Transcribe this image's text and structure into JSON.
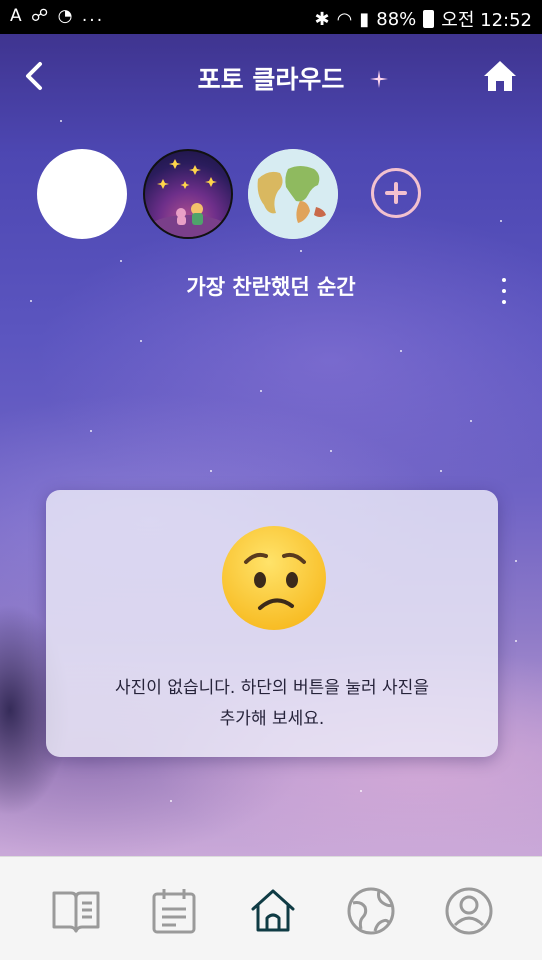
{
  "status_bar": {
    "left": "A ☍ ◔ ...",
    "battery": "88%",
    "time": "오전 12:52"
  },
  "header": {
    "title": "포토 클라우드",
    "back_icon": "chevron-left-icon",
    "home_icon": "home-icon"
  },
  "albums": {
    "items": [
      {
        "name": "album-white",
        "color": "#ffffff"
      },
      {
        "name": "album-little-prince",
        "color": "#2a1c5c"
      },
      {
        "name": "album-world-map",
        "color": "#e6f0ef"
      }
    ],
    "add_icon": "plus-circle-icon"
  },
  "album_title": "가장 찬란했던 순간",
  "empty_state": {
    "emoji": "worried-face-emoji",
    "line1": "사진이 없습니다. 하단의 버튼을 눌러 사진을",
    "line2": "추가해 보세요."
  },
  "bottom_nav": {
    "items": [
      {
        "icon": "book-icon",
        "active": false
      },
      {
        "icon": "calendar-icon",
        "active": false
      },
      {
        "icon": "home-icon",
        "active": true
      },
      {
        "icon": "globe-icon",
        "active": false
      },
      {
        "icon": "profile-icon",
        "active": false
      }
    ],
    "active_color": "#0f3b44",
    "inactive_color": "#9a9a9a"
  }
}
